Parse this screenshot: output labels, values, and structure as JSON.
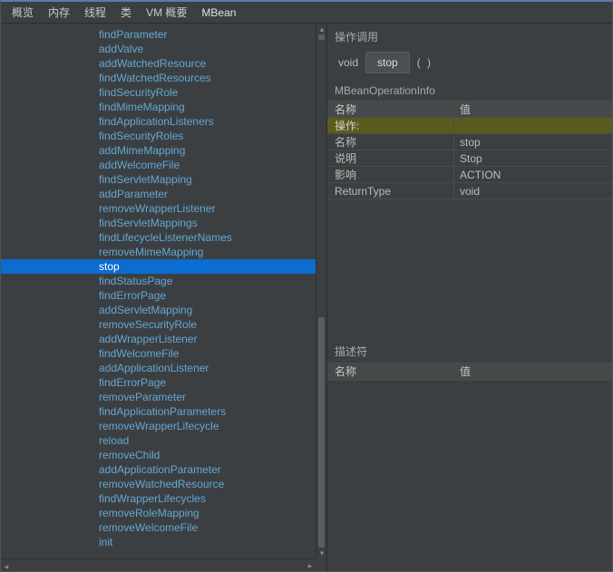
{
  "tabs": [
    "概览",
    "内存",
    "线程",
    "类",
    "VM 概要",
    "MBean"
  ],
  "tree": {
    "items": [
      "findParameter",
      "addValve",
      "addWatchedResource",
      "findWatchedResources",
      "findSecurityRole",
      "findMimeMapping",
      "findApplicationListeners",
      "findSecurityRoles",
      "addMimeMapping",
      "addWelcomeFile",
      "findServletMapping",
      "addParameter",
      "removeWrapperListener",
      "findServletMappings",
      "findLifecycleListenerNames",
      "removeMimeMapping",
      "stop",
      "findStatusPage",
      "findErrorPage",
      "addServletMapping",
      "removeSecurityRole",
      "addWrapperListener",
      "findWelcomeFile",
      "addApplicationListener",
      "findErrorPage",
      "removeParameter",
      "findApplicationParameters",
      "removeWrapperLifecycle",
      "reload",
      "removeChild",
      "addApplicationParameter",
      "removeWatchedResource",
      "findWrapperLifecycles",
      "removeRoleMapping",
      "removeWelcomeFile",
      "init"
    ],
    "selected_index": 16
  },
  "op": {
    "section": "操作调用",
    "return": "void",
    "button": "stop",
    "paren": "( )"
  },
  "info": {
    "title": "MBeanOperationInfo",
    "header": {
      "name": "名称",
      "value": "值"
    },
    "oplabel": "操作:",
    "rows": [
      {
        "name": "名称",
        "value": "stop"
      },
      {
        "name": "说明",
        "value": "Stop"
      },
      {
        "name": "影响",
        "value": "ACTION"
      },
      {
        "name": "ReturnType",
        "value": "void"
      }
    ]
  },
  "desc": {
    "title": "描述符",
    "header": {
      "name": "名称",
      "value": "值"
    }
  }
}
